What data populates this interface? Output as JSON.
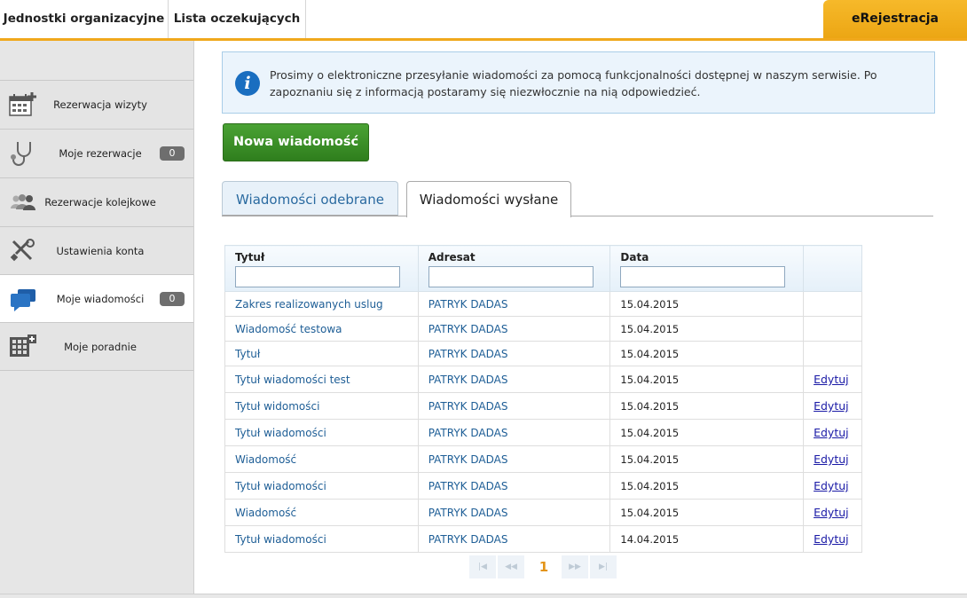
{
  "topbar": {
    "tabs": [
      "Jednostki organizacyjne",
      "Lista oczekujących"
    ],
    "brand": "eRejestracja",
    "accent": "#f0a81c"
  },
  "sidebar": {
    "items": [
      {
        "label": "Rezerwacja wizyty",
        "icon": "calendar-add-icon"
      },
      {
        "label": "Moje rezerwacje",
        "icon": "stethoscope-icon",
        "badge": "0"
      },
      {
        "label": "Rezerwacje kolejkowe",
        "icon": "people-queue-icon"
      },
      {
        "label": "Ustawienia konta",
        "icon": "tools-icon"
      },
      {
        "label": "Moje wiadomości",
        "icon": "chat-bubbles-icon",
        "badge": "0"
      },
      {
        "label": "Moje poradnie",
        "icon": "building-grid-icon"
      }
    ]
  },
  "main": {
    "info": "Prosimy o elektroniczne przesyłanie wiadomości za pomocą funkcjonalności dostępnej w naszym serwisie. Po zapoznaniu się z informacją postaramy się niezwłocznie na nią odpowiedzieć.",
    "new_message_button": "Nowa wiadomość",
    "tabs": [
      "Wiadomości odebrane",
      "Wiadomości wysłane"
    ],
    "table": {
      "headers": [
        "Tytuł",
        "Adresat",
        "Data"
      ],
      "rows": [
        {
          "title": "Zakres realizowanych uslug",
          "recipient": "PATRYK DADAS",
          "date": "15.04.2015",
          "action": ""
        },
        {
          "title": "Wiadomość testowa",
          "recipient": "PATRYK DADAS",
          "date": "15.04.2015",
          "action": ""
        },
        {
          "title": "Tytuł",
          "recipient": "PATRYK DADAS",
          "date": "15.04.2015",
          "action": ""
        },
        {
          "title": "Tytuł wiadomości test",
          "recipient": "PATRYK DADAS",
          "date": "15.04.2015",
          "action": "Edytuj"
        },
        {
          "title": "Tytuł widomości",
          "recipient": "PATRYK DADAS",
          "date": "15.04.2015",
          "action": "Edytuj"
        },
        {
          "title": "Tytuł wiadomości",
          "recipient": "PATRYK DADAS",
          "date": "15.04.2015",
          "action": "Edytuj"
        },
        {
          "title": "Wiadomość",
          "recipient": "PATRYK DADAS",
          "date": "15.04.2015",
          "action": "Edytuj"
        },
        {
          "title": "Tytuł wiadomości",
          "recipient": "PATRYK DADAS",
          "date": "15.04.2015",
          "action": "Edytuj"
        },
        {
          "title": "Wiadomość",
          "recipient": "PATRYK DADAS",
          "date": "15.04.2015",
          "action": "Edytuj"
        },
        {
          "title": "Tytuł wiadomości",
          "recipient": "PATRYK DADAS",
          "date": "14.04.2015",
          "action": "Edytuj"
        }
      ]
    },
    "pager": {
      "current": "1"
    }
  }
}
